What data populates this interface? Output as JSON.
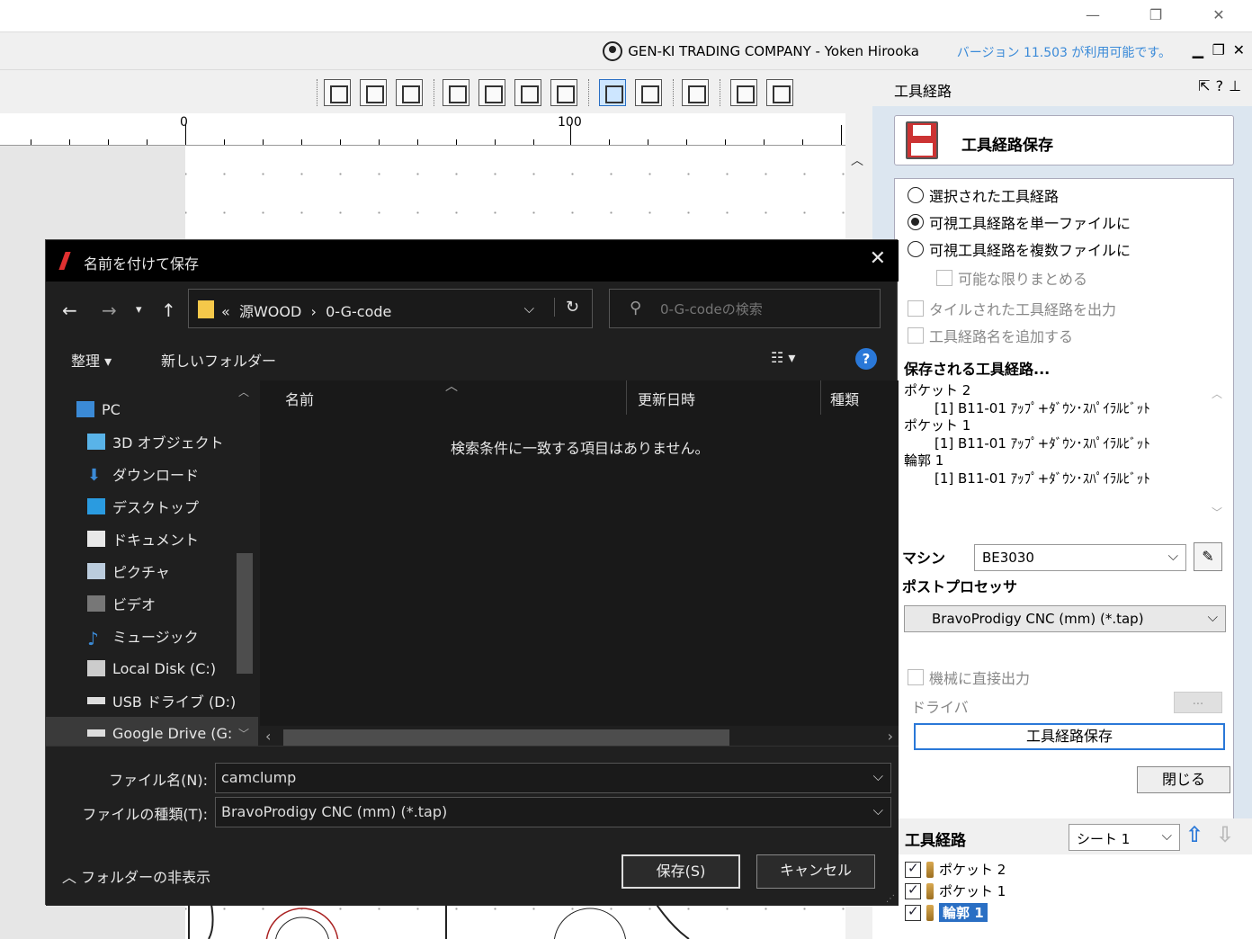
{
  "app": {
    "company": "GEN-KI TRADING COMPANY - Yoken Hirooka",
    "version_notice": "バージョン 11.503 が利用可能です。",
    "ruler": {
      "label_0": "0",
      "label_100": "100"
    }
  },
  "panel": {
    "title": "工具経路",
    "save_card_label": "工具経路保存",
    "radio_selected": "可視工具経路を単一ファイルに",
    "radio_options": [
      "選択された工具経路",
      "可視工具経路を単一ファイルに",
      "可視工具経路を複数ファイルに"
    ],
    "merge_label": "可能な限りまとめる",
    "tiled_label": "タイルされた工具経路を出力",
    "add_name_label": "工具経路名を追加する",
    "saved_heading": "保存される工具経路...",
    "saved_list": [
      {
        "name": "ポケット 2",
        "tool": "[1] B11-01 ｱｯﾌﾟ+ﾀﾞｳﾝ･ｽﾊﾟｲﾗﾙﾋﾞｯﾄ"
      },
      {
        "name": "ポケット 1",
        "tool": "[1] B11-01 ｱｯﾌﾟ+ﾀﾞｳﾝ･ｽﾊﾟｲﾗﾙﾋﾞｯﾄ"
      },
      {
        "name": "輪郭 1",
        "tool": "[1] B11-01 ｱｯﾌﾟ+ﾀﾞｳﾝ･ｽﾊﾟｲﾗﾙﾋﾞｯﾄ"
      }
    ],
    "machine_label": "マシン",
    "machine_value": "BE3030",
    "post_label": "ポストプロセッサ",
    "post_value": "BravoProdigy CNC (mm) (*.tap)",
    "direct_output_label": "機械に直接出力",
    "driver_label": "ドライバ",
    "driver_button": "...",
    "save_button": "工具経路保存",
    "close_button": "閉じる",
    "tree_title": "工具経路",
    "sheet_value": "シート 1",
    "tree_items": [
      {
        "label": "ポケット 2",
        "checked": true,
        "selected": false
      },
      {
        "label": "ポケット 1",
        "checked": true,
        "selected": false
      },
      {
        "label": "輪郭 1",
        "checked": true,
        "selected": true
      }
    ]
  },
  "dialog": {
    "title": "名前を付けて保存",
    "path_prefix": "«",
    "path_parent": "源WOOD",
    "path_sep": "›",
    "path_current": "0-G-code",
    "search_placeholder": "0-G-codeの検索",
    "organize": "整理 ▾",
    "new_folder": "新しいフォルダー",
    "help": "?",
    "nav_items": [
      "PC",
      "3D オブジェクト",
      "ダウンロード",
      "デスクトップ",
      "ドキュメント",
      "ピクチャ",
      "ビデオ",
      "ミュージック",
      "Local Disk (C:)",
      "USB ドライブ (D:)",
      "Google Drive (G:"
    ],
    "columns": [
      "名前",
      "更新日時",
      "種類"
    ],
    "empty_message": "検索条件に一致する項目はありません。",
    "filename_label": "ファイル名(N):",
    "filename_value": "camclump",
    "filetype_label": "ファイルの種類(T):",
    "filetype_value": "BravoProdigy CNC (mm) (*.tap)",
    "hide_folders": "フォルダーの非表示",
    "save_btn": "保存(S)",
    "cancel_btn": "キャンセル"
  },
  "colors": {
    "accent": "#2a78d8",
    "dialog_bg": "#1f1f1f",
    "panel_bg": "#dce6f0"
  }
}
